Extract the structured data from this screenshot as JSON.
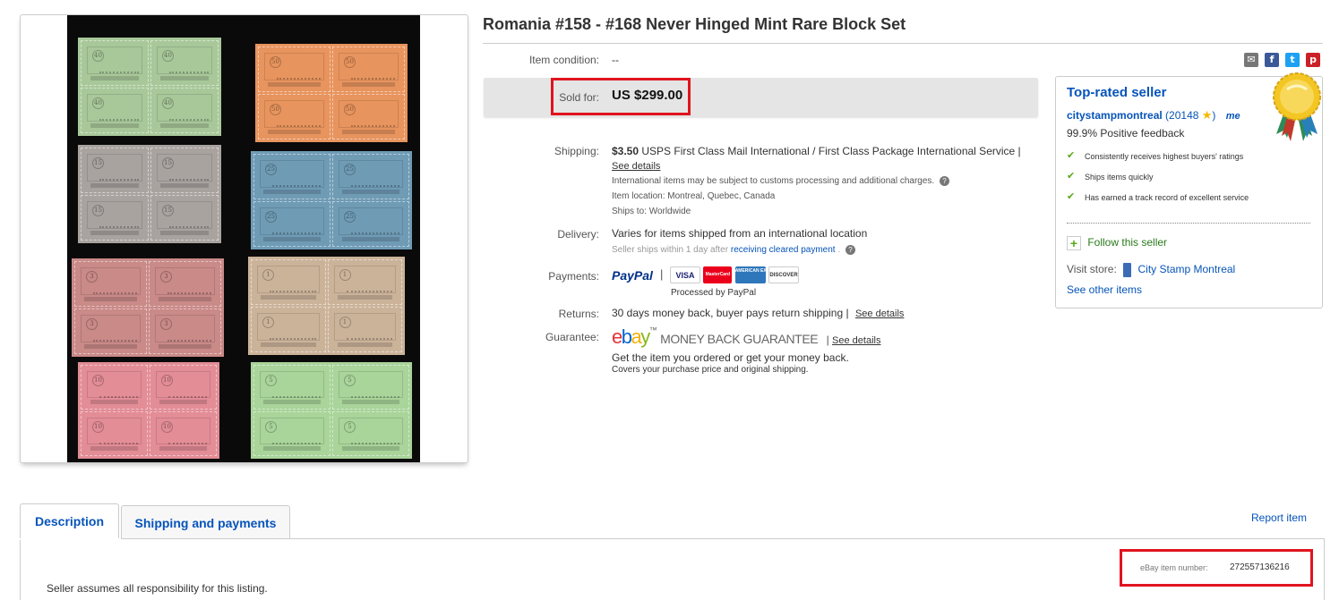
{
  "listing": {
    "title": "Romania #158 - #168 Never Hinged Mint Rare Block Set",
    "condition_label": "Item condition:",
    "condition_value": "--",
    "sold_label": "Sold for:",
    "sold_price": "US $299.00"
  },
  "stamp_blocks": [
    {
      "color": "#a8c89a",
      "denom": "40"
    },
    {
      "color": "#e8945e",
      "denom": "50"
    },
    {
      "color": "#a9a3a0",
      "denom": "15"
    },
    {
      "color": "#6f9bb5",
      "denom": "25"
    },
    {
      "color": "#c98a88",
      "denom": "3"
    },
    {
      "color": "#cbb39a",
      "denom": "1"
    },
    {
      "color": "#e38d97",
      "denom": "10"
    },
    {
      "color": "#a9d49a",
      "denom": "5"
    }
  ],
  "shipping": {
    "label": "Shipping:",
    "cost": "$3.50",
    "service": "USPS First Class Mail International / First Class Package International Service",
    "sep": "|",
    "see_details": "See details",
    "customs_note": "International items may be subject to customs processing and additional charges.",
    "location": "Item location:  Montreal, Quebec, Canada",
    "ships_to": "Ships to:  Worldwide"
  },
  "delivery": {
    "label": "Delivery:",
    "value": "Varies for items shipped from an international location",
    "note_prefix": "Seller ships within 1 day after",
    "note_link": "receiving cleared payment",
    "note_suffix": "."
  },
  "payments": {
    "label": "Payments:",
    "paypal": "PayPal",
    "cards": [
      "VISA",
      "MasterCard",
      "AMERICAN EXPRESS",
      "DISCOVER"
    ],
    "processed_by": "Processed by PayPal"
  },
  "returns": {
    "label": "Returns:",
    "value": "30 days money back, buyer pays return shipping",
    "sep": "|",
    "see_details": "See details"
  },
  "guarantee": {
    "label": "Guarantee:",
    "ebay_letters": [
      "e",
      "b",
      "a",
      "y"
    ],
    "ebay_colors": [
      "#e53238",
      "#0064d2",
      "#f5af02",
      "#86b817"
    ],
    "tm": "™",
    "title": "MONEY BACK GUARANTEE",
    "sep": "|",
    "see_details": "See details",
    "line1": "Get the item you ordered or get your money back.",
    "line2": "Covers your purchase price and original shipping."
  },
  "seller": {
    "heading": "Top-rated seller",
    "name": "citystampmontreal",
    "feedback_count": "(20148",
    "feedback_close": ")",
    "me_badge": "me",
    "positive": "99.9% Positive feedback",
    "badges": [
      "Consistently receives highest buyers' ratings",
      "Ships items quickly",
      "Has earned a track record of excellent service"
    ],
    "follow": "Follow this seller",
    "visit_label": "Visit store:",
    "store_name": "City Stamp Montreal",
    "see_other": "See other items"
  },
  "tabs": {
    "description": "Description",
    "shipping": "Shipping and payments",
    "report": "Report item"
  },
  "description": {
    "item_number_label": "eBay item number:",
    "item_number": "272557136216",
    "responsibility": "Seller assumes all responsibility for this listing."
  },
  "colors": {
    "link": "#0654ba",
    "highlight": "#e0141e",
    "check": "#5ba71b"
  }
}
